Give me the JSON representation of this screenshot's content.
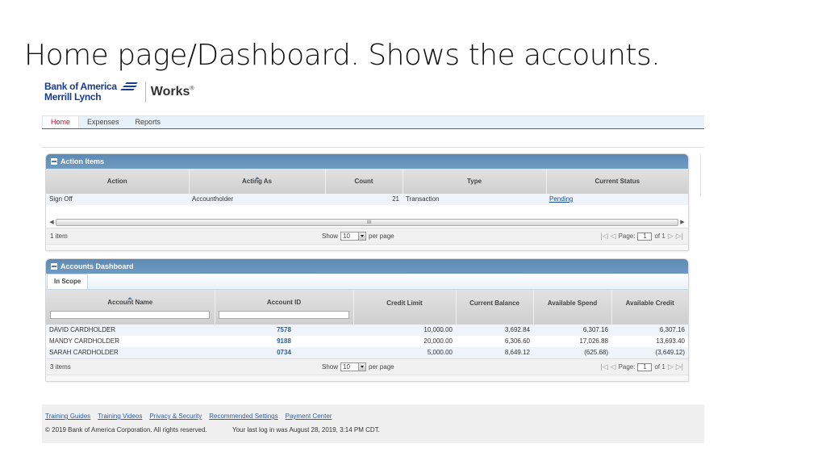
{
  "slide": {
    "title": "Home page/Dashboard. Shows the accounts."
  },
  "brand": {
    "line1": "Bank of America",
    "line2": "Merrill Lynch",
    "product": "Works",
    "registered": "®"
  },
  "nav": {
    "items": [
      {
        "label": "Home",
        "active": true
      },
      {
        "label": "Expenses",
        "active": false
      },
      {
        "label": "Reports",
        "active": false
      }
    ]
  },
  "action_items": {
    "title": "Action Items",
    "columns": [
      "Action",
      "Acting As",
      "Count",
      "Type",
      "Current Status"
    ],
    "sorted_column": "Acting As",
    "rows": [
      {
        "action": "Sign Off",
        "acting_as": "Accountholder",
        "count": "21",
        "type": "Transaction",
        "status": "Pending"
      }
    ],
    "scroll_grip": "III",
    "pager": {
      "count_text": "1 item",
      "show": "Show",
      "per_page_value": "10",
      "per_page": "per page",
      "page_label": "Page:",
      "page_value": "1",
      "of_text": "of 1"
    }
  },
  "accounts_dashboard": {
    "title": "Accounts Dashboard",
    "tabs": [
      "In Scope"
    ],
    "columns": [
      "Account Name",
      "Account ID",
      "Credit Limit",
      "Current Balance",
      "Available Spend",
      "Available Credit"
    ],
    "sorted_column": "Account Name",
    "rows": [
      {
        "name": "DAVID CARDHOLDER",
        "id": "7578",
        "credit_limit": "10,000.00",
        "current_balance": "3,692.84",
        "available_spend": "6,307.16",
        "available_credit": "6,307.16"
      },
      {
        "name": "MANDY CARDHOLDER",
        "id": "9188",
        "credit_limit": "20,000.00",
        "current_balance": "6,306.60",
        "available_spend": "17,026.88",
        "available_credit": "13,693.40"
      },
      {
        "name": "SARAH CARDHOLDER",
        "id": "0734",
        "credit_limit": "5,000.00",
        "current_balance": "8,649.12",
        "available_spend": "(625.68)",
        "available_credit": "(3,649.12)"
      }
    ],
    "pager": {
      "count_text": "3 items",
      "show": "Show",
      "per_page_value": "10",
      "per_page": "per page",
      "page_label": "Page:",
      "page_value": "1",
      "of_text": "of 1"
    }
  },
  "footer": {
    "links": [
      "Training Guides",
      "Training Videos",
      "Privacy & Security",
      "Recommended Settings",
      "Payment Center"
    ],
    "copyright": "© 2019 Bank of America Corporation. All rights reserved.",
    "last_login": "Your last log in was August 28, 2019, 3:14 PM CDT."
  },
  "colors": {
    "brand_blue": "#1a3c8c",
    "panel_header": "#6690b9",
    "active_nav": "#c41230",
    "link": "#2b5ea8"
  }
}
